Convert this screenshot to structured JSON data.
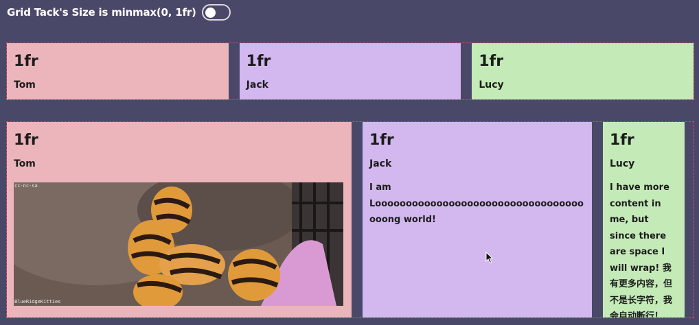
{
  "header": {
    "title": "Grid Tack's Size is minmax(0, 1fr)",
    "toggle_on": false
  },
  "grid_top": {
    "cards": [
      {
        "size": "1fr",
        "name": "Tom",
        "color": "#ecb5bb"
      },
      {
        "size": "1fr",
        "name": "Jack",
        "color": "#d2b8ee"
      },
      {
        "size": "1fr",
        "name": "Lucy",
        "color": "#c4ebb7"
      }
    ]
  },
  "grid_bottom": {
    "cards": [
      {
        "size": "1fr",
        "name": "Tom",
        "color": "#ecb5bb",
        "image": "kitten-image",
        "image_label_top": "cc-nc-sa",
        "image_label_bottom": "BlueRidgeKitties"
      },
      {
        "size": "1fr",
        "name": "Jack",
        "color": "#d2b8ee",
        "text": "I am Looooooooooooooooooooooooooooooooooooong world!"
      },
      {
        "size": "1fr",
        "name": "Lucy",
        "color": "#c4ebb7",
        "text": "I have more content in me, but since there are space I will wrap! 我有更多内容，但不是长字符，我会自动断行！"
      }
    ]
  },
  "colors": {
    "background": "#4a4868",
    "grid_border": "#d24a6e"
  }
}
